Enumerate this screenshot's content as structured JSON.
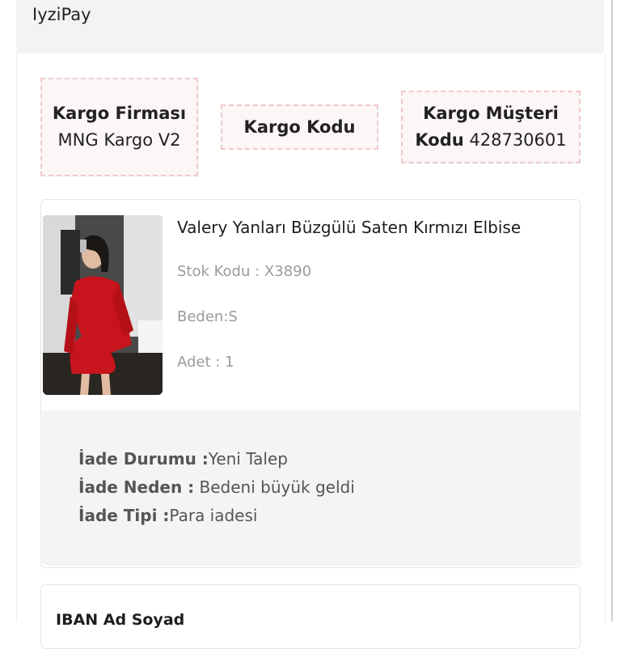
{
  "header": {
    "title": "IyziPay"
  },
  "cargo": {
    "company_label": "Kargo Firması",
    "company_value": "MNG Kargo V2",
    "code_label": "Kargo Kodu",
    "code_value": "",
    "customer_code_label": "Kargo Müşteri Kodu",
    "customer_code_value": "428730601"
  },
  "product": {
    "title": "Valery Yanları Büzgülü Saten Kırmızı Elbise",
    "stock_code": "Stok Kodu : X3890",
    "size": "Beden:S",
    "quantity": "Adet : 1"
  },
  "return_info": {
    "status_label": "İade Durumu :",
    "status_value": "Yeni Talep",
    "reason_label": "İade Neden :",
    "reason_value": " Bedeni büyük geldi",
    "type_label": "İade Tipi :",
    "type_value": "Para iadesi"
  },
  "iban": {
    "title": "IBAN Ad Soyad"
  },
  "colors": {
    "accent_dress": "#c8141c",
    "dashed_border": "#f0c8c8",
    "panel_bg": "#f4f4f4"
  }
}
